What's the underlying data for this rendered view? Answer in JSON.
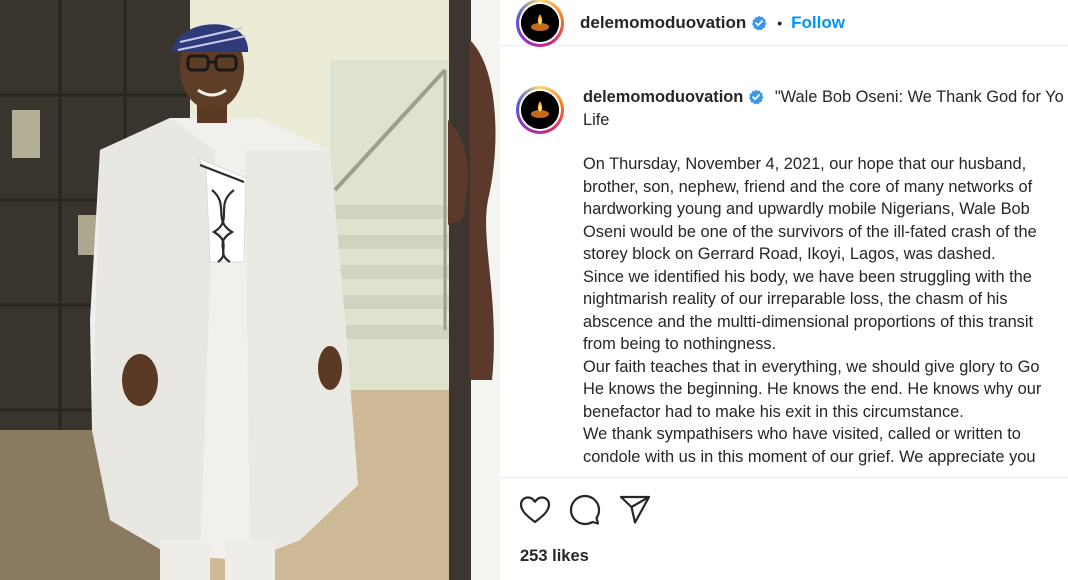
{
  "post": {
    "username": "delemomoduovation",
    "follow_label": "Follow",
    "separator": "•",
    "caption_title_line1": "\"Wale Bob Oseni: We Thank God for Yo",
    "caption_title_line2": "Life",
    "caption_lines": [
      "On Thursday, November 4, 2021, our hope that our husband,",
      "brother, son, nephew, friend and the core of many networks of",
      "hardworking young and upwardly mobile Nigerians, Wale Bob",
      "Oseni would be one of the survivors of the ill-fated crash of the",
      "storey block on Gerrard Road, Ikoyi, Lagos, was dashed.",
      "Since we identified his body, we have been struggling with the",
      "nightmarish reality of our irreparable loss, the chasm of his",
      "abscence and the multti-dimensional proportions of this transit",
      "from being to nothingness.",
      "Our faith teaches that in everything, we should give glory to Go",
      "He knows the beginning. He knows the end. He knows why our",
      "benefactor had to make his exit in this circumstance.",
      "We thank sympathisers who have visited, called or written to",
      "condole with us in this moment of our grief. We appreciate you"
    ],
    "likes_label": "253 likes"
  },
  "icons": {
    "verified": "verified-badge-icon",
    "like": "heart-icon",
    "comment": "comment-icon",
    "share": "paper-plane-icon"
  },
  "colors": {
    "accent": "#0095f6",
    "verified": "#3897f0",
    "text": "#262626"
  }
}
